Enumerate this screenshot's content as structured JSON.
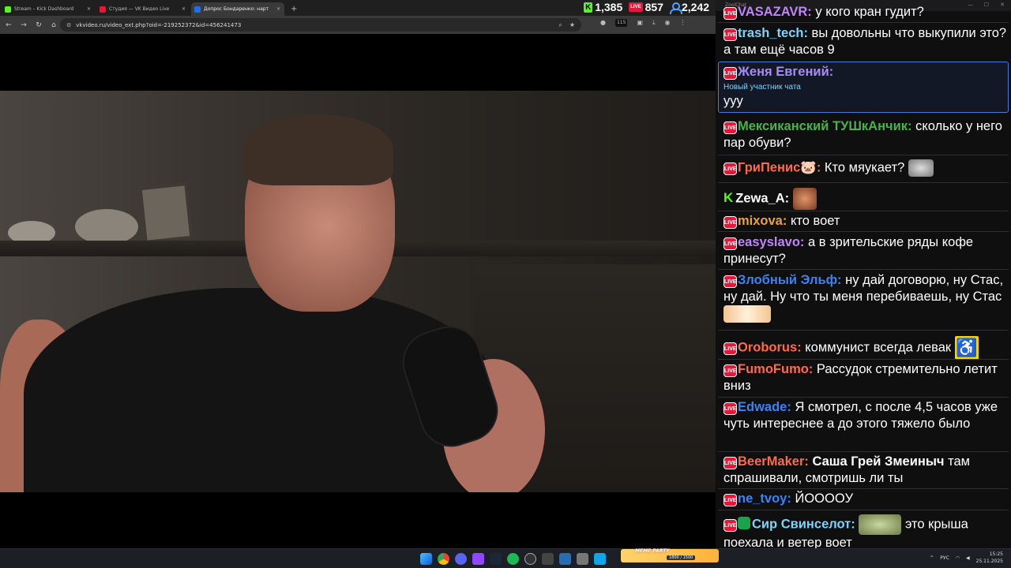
{
  "browser": {
    "tabs": [
      {
        "title": "Stream – Kick Dashboard",
        "color": "#53fc18",
        "active": false
      },
      {
        "title": "Студия — VK Видео Live",
        "color": "#e8173a",
        "active": false
      },
      {
        "title": "Допрос Бондаренко: нарт",
        "color": "#1f6feb",
        "active": true
      }
    ],
    "new_tab_symbol": "+",
    "url": "vkvideo.ru/video_ext.php?oid=-219252372&id=456241473",
    "extension_badge": "115"
  },
  "stream_stats": {
    "kick_viewers": "1,385",
    "vk_viewers": "857",
    "total_viewers": "2,242",
    "vk_badge": "LIVE"
  },
  "chat": {
    "window_title": "ZoolChat",
    "messages": [
      {
        "nick": "VASAZAVR:",
        "text": "у кого кран гудит?",
        "color": "#c084fc",
        "platform": "vk"
      },
      {
        "nick": "trash_tech:",
        "text": "вы довольны что выкупили это? а там ещё часов 9",
        "color": "#7dd3fc",
        "platform": "vk"
      },
      {
        "nick": "Женя Евгений:",
        "text": "ууу",
        "subtitle": "Новый участник чата",
        "color": "#a78bfa",
        "platform": "vk"
      },
      {
        "nick": "Мексиканский ТУШкАнчик:",
        "text": "сколько у него пар обуви?",
        "color": "#4caf50",
        "platform": "vk"
      },
      {
        "nick": "ГриПенис🐷:",
        "text": "Кто мяукает?",
        "color": "#ff6b4a",
        "platform": "vk"
      },
      {
        "nick": "Zewa_A:",
        "text": "",
        "color": "#ffffff",
        "platform": "kick"
      },
      {
        "nick": "mixova:",
        "text": "кто воет",
        "color": "#e8a33d",
        "platform": "vk"
      },
      {
        "nick": "easyslavo:",
        "text": "а в зрительские ряды кофе принесут?",
        "color": "#c084fc",
        "platform": "vk"
      },
      {
        "nick": "Злобный Эльф:",
        "text": "ну дай договорю, ну Стас, ну дай. Ну что ты меня перебиваешь, ну Стас",
        "color": "#3b82f6",
        "platform": "vk"
      },
      {
        "nick": "Oroborus:",
        "text": "коммунист всегда левак",
        "color": "#ff6b4a",
        "platform": "vk"
      },
      {
        "nick": "FumoFumo:",
        "text": "Рассудок стремительно летит вниз",
        "color": "#ff6b4a",
        "platform": "vk"
      },
      {
        "nick": "Edwade:",
        "text": "Я смотрел, с после 4,5 часов уже чуть интереснее а до этого тяжело было",
        "color": "#3b82f6",
        "platform": "vk"
      },
      {
        "nick": "BeerMaker:",
        "bold_text": "Саша Грей Змеиныч",
        "text": "там спрашивали, смотришь ли ты",
        "color": "#ff6b4a",
        "platform": "vk"
      },
      {
        "nick": "ne_tvoy:",
        "text": "ЙОООOУ",
        "color": "#3b82f6",
        "platform": "vk"
      },
      {
        "nick": "Сир Свинселот:",
        "text": "это крыша поехала и ветер воет",
        "color": "#7dd3fc",
        "platform": "vk"
      }
    ]
  },
  "taskbar": {
    "overlay_label": "MEME PARTY",
    "overlay_count": "1800 / 1500",
    "lang": "РУС",
    "time": "15:25",
    "date": "25.11.2025"
  },
  "icons": {
    "back": "back-arrow-icon",
    "forward": "forward-arrow-icon",
    "reload": "reload-icon",
    "home": "home-icon",
    "star": "star-icon",
    "menu": "kebab-menu-icon"
  }
}
